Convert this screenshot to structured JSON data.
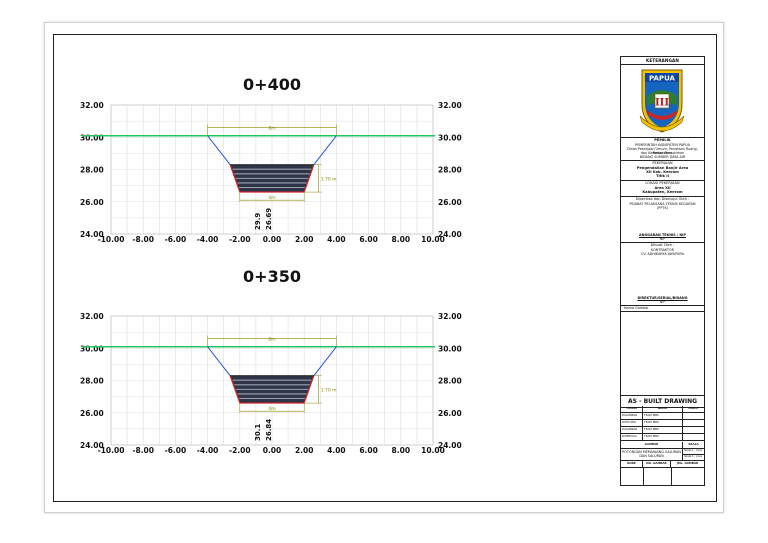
{
  "drawing": {
    "sections": [
      {
        "station": "0+400",
        "left_labels": [
          "32.00",
          "30.00",
          "28.00",
          "26.00",
          "24.00"
        ],
        "right_labels": [
          "32.00",
          "30.00",
          "28.00",
          "26.00",
          "24.00"
        ],
        "x_labels": [
          "-10.00",
          "-8.00",
          "-6.00",
          "-4.00",
          "-2.00",
          "0.00",
          "2.00",
          "4.00",
          "6.00",
          "8.00",
          "10.00"
        ],
        "dim_top": "8m",
        "dim_bottom": "4m",
        "dim_depth": "1.70 m",
        "elev_1": "29.9",
        "elev_2": "26.69"
      },
      {
        "station": "0+350",
        "left_labels": [
          "32.00",
          "30.00",
          "28.00",
          "26.00",
          "24.00"
        ],
        "right_labels": [
          "32.00",
          "30.00",
          "28.00",
          "26.00",
          "24.00"
        ],
        "x_labels": [
          "-10.00",
          "-8.00",
          "-6.00",
          "-4.00",
          "-2.00",
          "0.00",
          "2.00",
          "4.00",
          "6.00",
          "8.00",
          "10.00"
        ],
        "dim_top": "8m",
        "dim_bottom": "4m",
        "dim_depth": "1.70 m",
        "elev_1": "30.1",
        "elev_2": "26.84"
      }
    ],
    "colors": {
      "ground": "#22c55e",
      "slope_blue": "#1d4ed8",
      "slope_red": "#dc2626",
      "fill": "#2f3548",
      "fill_stripe": "#9ca3af",
      "dimension": "#8a8a00",
      "grid": "#dddddd"
    }
  },
  "titleblock": {
    "heading": "KETERANGAN",
    "logo_text": "PAPUA",
    "logo_roman": "III",
    "owner_label": "PEMILIK",
    "owner_lines": [
      "PEMERINTAH KABUPATEN PAPUA",
      "Dinas Pekerjaan Umum, Penataan Ruang, Pertanahan",
      "dan Kawasan Pemukiman",
      "BIDANG SUMBER DAYA AIR"
    ],
    "job_label": "PEKERJAAN",
    "job_lines": [
      "Pengendalian Banjir Area",
      "XII Kab. Keerom",
      "Titik II"
    ],
    "location_label": "LOKASI PEKERJAAN",
    "location_lines": [
      "Area XII",
      "Kabupaten, Keerom"
    ],
    "checked_label": "Diperiksa dan Disetujui Oleh :",
    "checked_lines": [
      "PEJABAT PELAKSANA TEKNIS KEGIATAN",
      "(PPTK)"
    ],
    "approved_name": "ANGGARAN TEKNIS / NIP",
    "approved_line": "NIP",
    "made_label": "Dibuat Oleh :",
    "made_lines": [
      "KONTRAKTOR",
      "CV. ADHIKARYA JAYAPURA"
    ],
    "director_name": "DIREKTUR/SERIAL/BIDANG",
    "director_line": "NIP",
    "sheet_label": "Nama Gambar",
    "asbuilt_title": "AS - BUILT DRAWING",
    "asbuilt_headers": [
      "TUGAS",
      "NAMA",
      "PARAF"
    ],
    "asbuilt_rows": [
      [
        "DIGAMBAR",
        "TEAM MBS"
      ],
      [
        "DIHITUNG",
        "TEAM MBS"
      ],
      [
        "DIGAMBAR",
        "TEAM MBS"
      ],
      [
        "DIPERIKSA",
        "TEAM MBS"
      ]
    ],
    "drawing_name_header": "GAMBAR",
    "scale_header": "SKALA",
    "drawing_name": "POTONGAN MEMANJANG SALURAN DAN SALURAN",
    "scale_values": [
      "Skala 1 : xxxx",
      "Skala 1 : xxxx"
    ],
    "footer_headers": [
      "KODE",
      "NO. GAMBAR",
      "JML. GAMBAR"
    ]
  }
}
